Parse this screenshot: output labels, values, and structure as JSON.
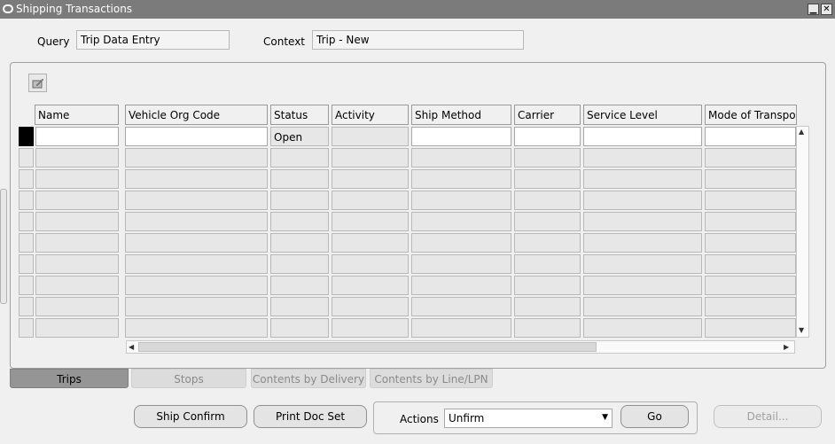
{
  "window": {
    "title": "Shipping Transactions",
    "minimize_icon": "minimize-icon",
    "close_icon": "close-icon",
    "close_label": "✕",
    "minimize_label": "▁"
  },
  "header": {
    "query_label": "Query",
    "query_value": "Trip Data Entry",
    "context_label": "Context",
    "context_value": "Trip - New"
  },
  "table": {
    "columns": [
      "Name",
      "Vehicle Org Code",
      "Status",
      "Activity",
      "Ship Method",
      "Carrier",
      "Service Level",
      "Mode of Transpor"
    ],
    "first_row": {
      "status": "Open"
    },
    "empty_row_count": 9
  },
  "tabs": [
    {
      "label": "Trips",
      "active": true
    },
    {
      "label": "Stops",
      "active": false
    },
    {
      "label": "Contents by Delivery",
      "active": false
    },
    {
      "label": "Contents by Line/LPN",
      "active": false
    }
  ],
  "buttons": {
    "ship_confirm": "Ship Confirm",
    "print_doc_set": "Print Doc Set",
    "actions_label": "Actions",
    "actions_value": "Unfirm",
    "go": "Go",
    "detail": "Detail..."
  },
  "colors": {
    "titlebar": "#7b7b7b",
    "active_tab": "#959595",
    "current_row_marker": "#000000"
  }
}
